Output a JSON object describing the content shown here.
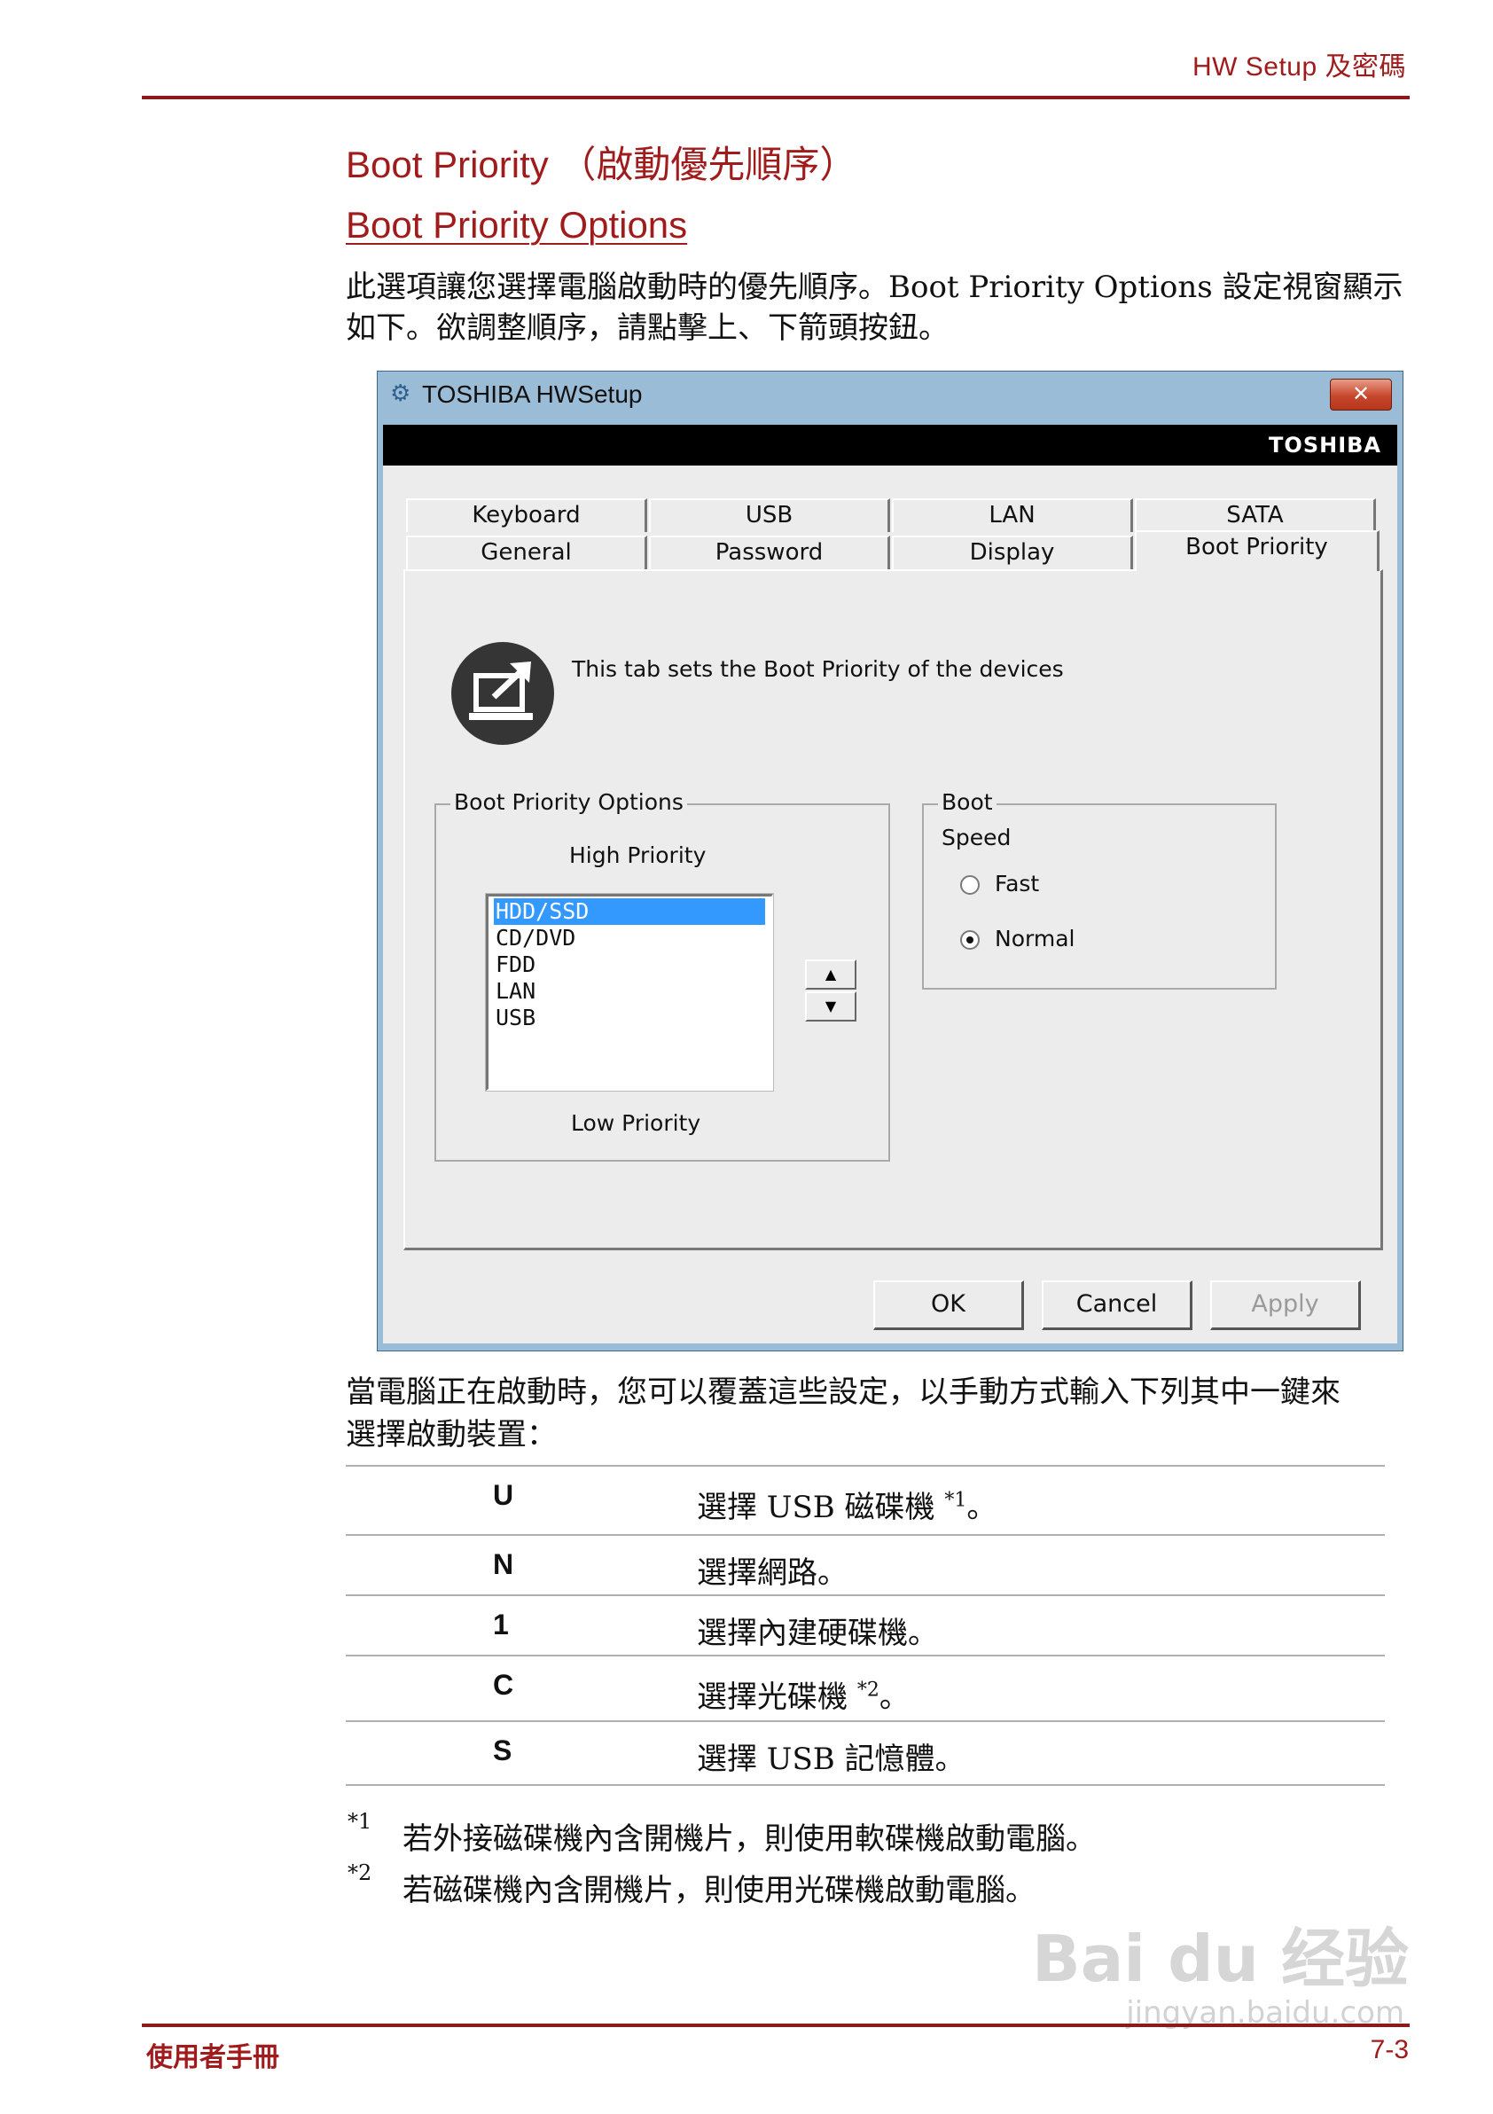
{
  "header": {
    "section": "HW Setup 及密碼"
  },
  "heading": "Boot Priority （啟動優先順序）",
  "subheading": "Boot Priority Options",
  "intro": {
    "line1": "此選項讓您選擇電腦啟動時的優先順序。Boot Priority Options 設定視窗顯示",
    "line2": "如下。欲調整順序，請點擊上、下箭頭按鈕。"
  },
  "window": {
    "title": "TOSHIBA HWSetup",
    "brand": "TOSHIBA",
    "close": "✕",
    "tabs_row1": [
      "Keyboard",
      "USB",
      "LAN",
      "SATA"
    ],
    "tabs_row2": [
      "General",
      "Password",
      "Display",
      "Boot Priority"
    ],
    "active_tab": "Boot Priority",
    "description": "This tab sets the Boot Priority of the devices",
    "boot_priority_group": {
      "legend": "Boot Priority Options",
      "high_label": "High Priority",
      "low_label": "Low Priority",
      "items": [
        "HDD/SSD",
        "CD/DVD",
        "FDD",
        "LAN",
        "USB"
      ],
      "selected": "HDD/SSD"
    },
    "boot_speed_group": {
      "legend": "Boot",
      "label": "Speed",
      "options": [
        "Fast",
        "Normal"
      ],
      "selected": "Normal"
    },
    "buttons": {
      "ok": "OK",
      "cancel": "Cancel",
      "apply": "Apply"
    }
  },
  "after_text": {
    "line1": "當電腦正在啟動時，您可以覆蓋這些設定，以手動方式輸入下列其中一鍵來",
    "line2": "選擇啟動裝置："
  },
  "shortcuts": [
    {
      "key": "U",
      "desc": "選擇 USB 磁碟機 ",
      "note": "*1",
      "end": "。"
    },
    {
      "key": "N",
      "desc": "選擇網路。",
      "note": "",
      "end": ""
    },
    {
      "key": "1",
      "desc": "選擇內建硬碟機。",
      "note": "",
      "end": ""
    },
    {
      "key": "C",
      "desc": "選擇光碟機 ",
      "note": "*2",
      "end": "。"
    },
    {
      "key": "S",
      "desc": "選擇 USB 記憶體。",
      "note": "",
      "end": ""
    }
  ],
  "footnotes": [
    {
      "mark": "*1",
      "text": "若外接磁碟機內含開機片，則使用軟碟機啟動電腦。"
    },
    {
      "mark": "*2",
      "text": "若磁碟機內含開機片，則使用光碟機啟動電腦。"
    }
  ],
  "footer": {
    "left": "使用者手冊",
    "right": "7-3"
  },
  "watermark": {
    "main": "Bai du 经验",
    "sub": "jingyan.baidu.com"
  }
}
